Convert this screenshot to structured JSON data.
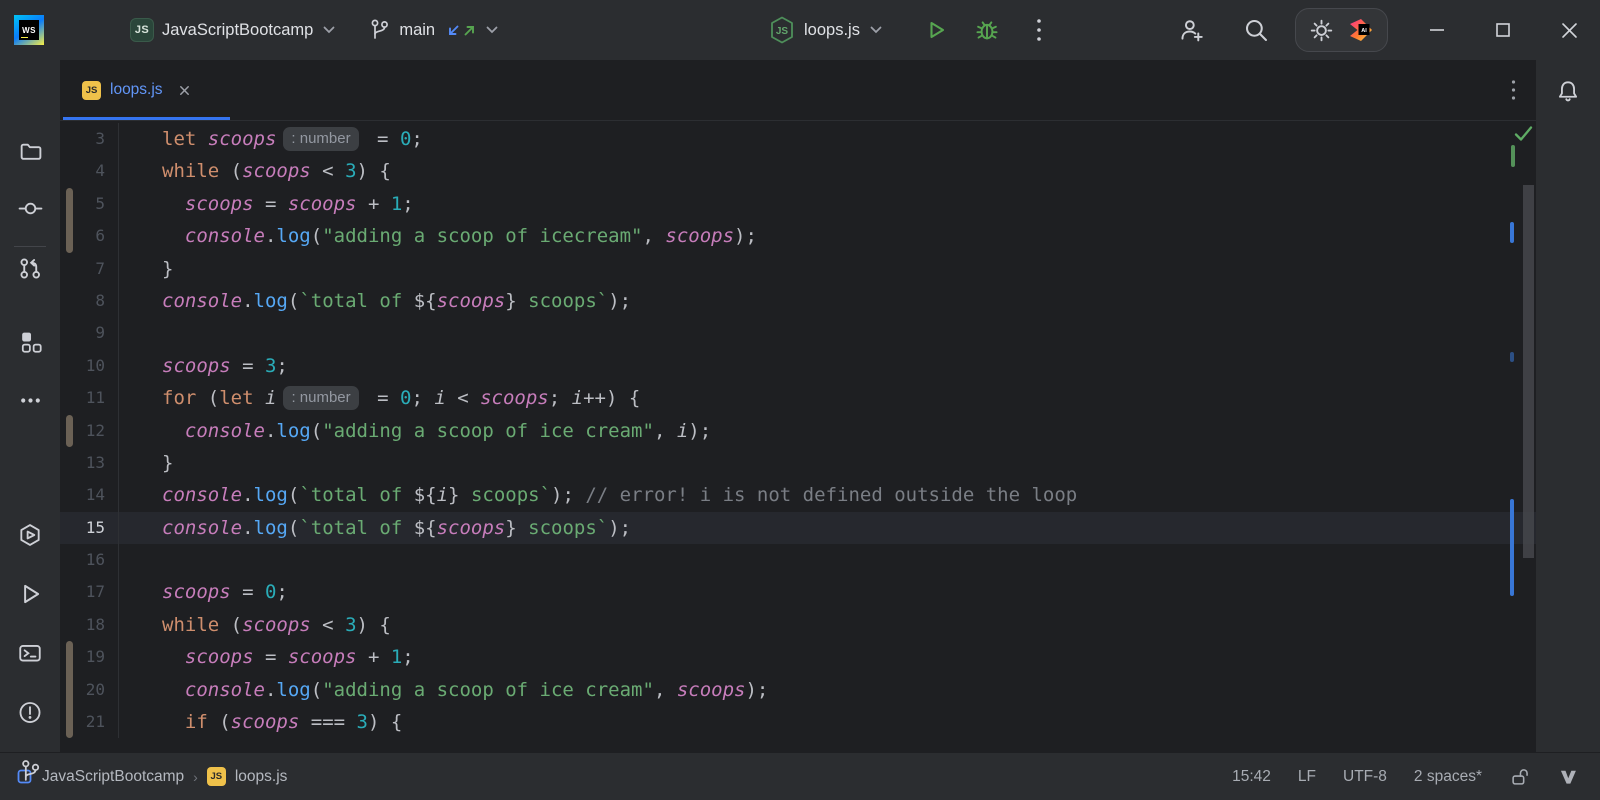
{
  "titlebar": {
    "app_icon_text": "WS",
    "project_icon_text": "JS",
    "project_name": "JavaScriptBootcamp",
    "branch": "main",
    "run_icon_text": "JS",
    "run_config": "loops.js",
    "ai_icon_text": "AI"
  },
  "tabbar": {
    "file_icon_text": "JS",
    "tab_label": "loops.js"
  },
  "sidebar_icons": [
    "project-folder",
    "commit",
    "pull-requests",
    "structure",
    "more",
    "services",
    "run",
    "terminal",
    "problems",
    "version-control"
  ],
  "editor": {
    "inspection_status": "ok",
    "lines": [
      {
        "n": "3",
        "m": false,
        "c": false,
        "t": [
          [
            "k",
            "let "
          ],
          [
            "g",
            "scoops"
          ],
          [
            "h",
            ": number"
          ],
          [
            "p",
            " = "
          ],
          [
            "n",
            "0"
          ],
          [
            "p",
            ";"
          ]
        ]
      },
      {
        "n": "4",
        "m": false,
        "c": false,
        "t": [
          [
            "k",
            "while"
          ],
          [
            "p",
            " ("
          ],
          [
            "g",
            "scoops"
          ],
          [
            "p",
            " < "
          ],
          [
            "n",
            "3"
          ],
          [
            "p",
            ") {"
          ]
        ]
      },
      {
        "n": "5",
        "m": true,
        "c": false,
        "t": [
          [
            "p",
            "  "
          ],
          [
            "g",
            "scoops"
          ],
          [
            "p",
            " = "
          ],
          [
            "g",
            "scoops"
          ],
          [
            "p",
            " + "
          ],
          [
            "n",
            "1"
          ],
          [
            "p",
            ";"
          ]
        ]
      },
      {
        "n": "6",
        "m": true,
        "c": false,
        "t": [
          [
            "p",
            "  "
          ],
          [
            "g",
            "console"
          ],
          [
            "p",
            "."
          ],
          [
            "f",
            "log"
          ],
          [
            "p",
            "("
          ],
          [
            "s",
            "\"adding a scoop of icecream\""
          ],
          [
            "p",
            ", "
          ],
          [
            "g",
            "scoops"
          ],
          [
            "p",
            ");"
          ]
        ]
      },
      {
        "n": "7",
        "m": false,
        "c": false,
        "t": [
          [
            "p",
            "}"
          ]
        ]
      },
      {
        "n": "8",
        "m": false,
        "c": false,
        "t": [
          [
            "g",
            "console"
          ],
          [
            "p",
            "."
          ],
          [
            "f",
            "log"
          ],
          [
            "p",
            "("
          ],
          [
            "s",
            "`total of "
          ],
          [
            "p",
            "${"
          ],
          [
            "g",
            "scoops"
          ],
          [
            "p",
            "}"
          ],
          [
            "s",
            " scoops`"
          ],
          [
            "p",
            ");"
          ]
        ]
      },
      {
        "n": "9",
        "m": false,
        "c": false,
        "t": []
      },
      {
        "n": "10",
        "m": false,
        "c": false,
        "t": [
          [
            "g",
            "scoops"
          ],
          [
            "p",
            " = "
          ],
          [
            "n",
            "3"
          ],
          [
            "p",
            ";"
          ]
        ]
      },
      {
        "n": "11",
        "m": false,
        "c": false,
        "t": [
          [
            "k",
            "for"
          ],
          [
            "p",
            " ("
          ],
          [
            "k",
            "let"
          ],
          [
            "p",
            " "
          ],
          [
            "l",
            "i"
          ],
          [
            "h",
            ": number"
          ],
          [
            "p",
            " = "
          ],
          [
            "n",
            "0"
          ],
          [
            "p",
            "; "
          ],
          [
            "l",
            "i"
          ],
          [
            "p",
            " < "
          ],
          [
            "g",
            "scoops"
          ],
          [
            "p",
            "; "
          ],
          [
            "l",
            "i"
          ],
          [
            "p",
            "++) {"
          ]
        ]
      },
      {
        "n": "12",
        "m": true,
        "c": false,
        "t": [
          [
            "p",
            "  "
          ],
          [
            "g",
            "console"
          ],
          [
            "p",
            "."
          ],
          [
            "f",
            "log"
          ],
          [
            "p",
            "("
          ],
          [
            "s",
            "\"adding a scoop of ice cream\""
          ],
          [
            "p",
            ", "
          ],
          [
            "l",
            "i"
          ],
          [
            "p",
            ");"
          ]
        ]
      },
      {
        "n": "13",
        "m": false,
        "c": false,
        "t": [
          [
            "p",
            "}"
          ]
        ]
      },
      {
        "n": "14",
        "m": false,
        "c": false,
        "t": [
          [
            "g",
            "console"
          ],
          [
            "p",
            "."
          ],
          [
            "f",
            "log"
          ],
          [
            "p",
            "("
          ],
          [
            "s",
            "`total of "
          ],
          [
            "p",
            "${"
          ],
          [
            "l",
            "i"
          ],
          [
            "p",
            "}"
          ],
          [
            "s",
            " scoops`"
          ],
          [
            "p",
            ");"
          ],
          [
            "c",
            " // error! i is not defined outside the loop"
          ]
        ]
      },
      {
        "n": "15",
        "m": false,
        "c": true,
        "t": [
          [
            "g",
            "console"
          ],
          [
            "p",
            "."
          ],
          [
            "f",
            "log"
          ],
          [
            "p",
            "("
          ],
          [
            "s",
            "`total of "
          ],
          [
            "p",
            "${"
          ],
          [
            "g",
            "scoops"
          ],
          [
            "p",
            "}"
          ],
          [
            "s",
            " scoops`"
          ],
          [
            "p",
            ");"
          ]
        ]
      },
      {
        "n": "16",
        "m": false,
        "c": false,
        "t": []
      },
      {
        "n": "17",
        "m": false,
        "c": false,
        "t": [
          [
            "g",
            "scoops"
          ],
          [
            "p",
            " = "
          ],
          [
            "n",
            "0"
          ],
          [
            "p",
            ";"
          ]
        ]
      },
      {
        "n": "18",
        "m": false,
        "c": false,
        "t": [
          [
            "k",
            "while"
          ],
          [
            "p",
            " ("
          ],
          [
            "g",
            "scoops"
          ],
          [
            "p",
            " < "
          ],
          [
            "n",
            "3"
          ],
          [
            "p",
            ") {"
          ]
        ]
      },
      {
        "n": "19",
        "m": true,
        "c": false,
        "t": [
          [
            "p",
            "  "
          ],
          [
            "g",
            "scoops"
          ],
          [
            "p",
            " = "
          ],
          [
            "g",
            "scoops"
          ],
          [
            "p",
            " + "
          ],
          [
            "n",
            "1"
          ],
          [
            "p",
            ";"
          ]
        ]
      },
      {
        "n": "20",
        "m": true,
        "c": false,
        "t": [
          [
            "p",
            "  "
          ],
          [
            "g",
            "console"
          ],
          [
            "p",
            "."
          ],
          [
            "f",
            "log"
          ],
          [
            "p",
            "("
          ],
          [
            "s",
            "\"adding a scoop of ice cream\""
          ],
          [
            "p",
            ", "
          ],
          [
            "g",
            "scoops"
          ],
          [
            "p",
            ");"
          ]
        ]
      },
      {
        "n": "21",
        "m": true,
        "c": false,
        "t": [
          [
            "p",
            "  "
          ],
          [
            "k",
            "if"
          ],
          [
            "p",
            " ("
          ],
          [
            "g",
            "scoops"
          ],
          [
            "p",
            " === "
          ],
          [
            "n",
            "3"
          ],
          [
            "p",
            ") {"
          ]
        ]
      }
    ]
  },
  "statusbar": {
    "project": "JavaScriptBootcamp",
    "file_icon_text": "JS",
    "file": "loops.js",
    "time": "15:42",
    "line_ending": "LF",
    "encoding": "UTF-8",
    "indent": "2 spaces*"
  },
  "colors": {
    "header_bg": "#2b2d30",
    "editor_bg": "#1e1f22",
    "accent_blue": "#3574F0",
    "tab_label_blue": "#6296F8",
    "run_green": "#57A550",
    "change_marker": "#6B6155",
    "token_keyword": "#CF8E6D",
    "token_global_var": "#C77DBB",
    "token_function": "#56A8F5",
    "token_string": "#6AAB73",
    "token_number": "#2AACB8",
    "token_comment": "#7A7E85",
    "file_icon_yellow": "#EFC14A"
  }
}
